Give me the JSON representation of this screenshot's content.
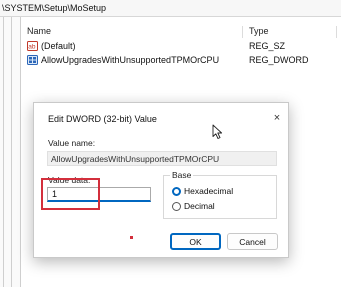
{
  "address_bar": {
    "path": "\\SYSTEM\\Setup\\MoSetup"
  },
  "list": {
    "columns": {
      "name": "Name",
      "type": "Type"
    },
    "rows": [
      {
        "icon": "string-value-icon",
        "name": "(Default)",
        "type": "REG_SZ"
      },
      {
        "icon": "dword-value-icon",
        "name": "AllowUpgradesWithUnsupportedTPMOrCPU",
        "type": "REG_DWORD"
      }
    ]
  },
  "dialog": {
    "title": "Edit DWORD (32-bit) Value",
    "close_glyph": "×",
    "value_name_label": "Value name:",
    "value_name": "AllowUpgradesWithUnsupportedTPMOrCPU",
    "value_data_label": "Value data:",
    "value_data": "1",
    "base_label": "Base",
    "base_options": [
      {
        "label": "Hexadecimal",
        "selected": true
      },
      {
        "label": "Decimal",
        "selected": false
      }
    ],
    "ok_label": "OK",
    "cancel_label": "Cancel"
  },
  "colors": {
    "accent": "#0067c0",
    "highlight": "#d32f3c"
  }
}
